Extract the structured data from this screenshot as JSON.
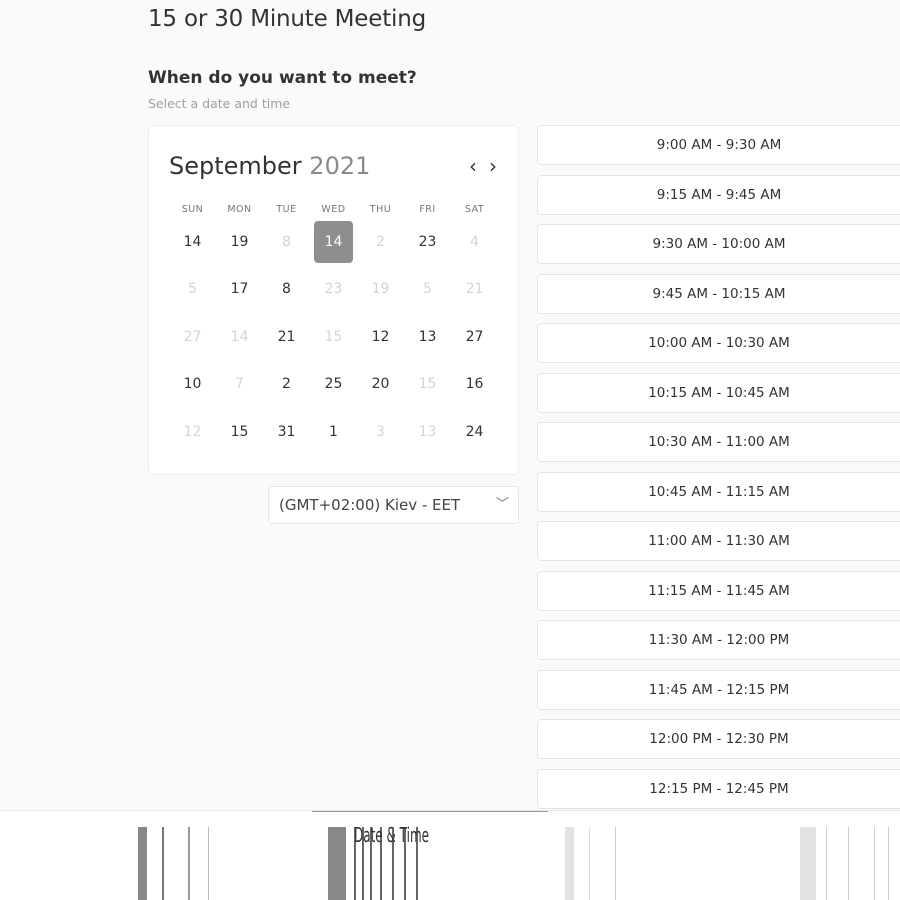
{
  "header": {
    "title": "15 or 30 Minute Meeting",
    "question": "When do you want to meet?",
    "hint": "Select a date and time"
  },
  "calendar": {
    "month": "September",
    "year": "2021",
    "prev_icon": "chevron-left-icon",
    "next_icon": "chevron-right-icon",
    "weekdays": [
      "SUN",
      "MON",
      "TUE",
      "WED",
      "THU",
      "FRI",
      "SAT"
    ],
    "rows": [
      [
        {
          "d": "14",
          "dim": false
        },
        {
          "d": "19",
          "dim": false
        },
        {
          "d": "8",
          "dim": true
        },
        {
          "d": "14",
          "dim": false,
          "selected": true
        },
        {
          "d": "2",
          "dim": true
        },
        {
          "d": "23",
          "dim": false
        },
        {
          "d": "4",
          "dim": true
        }
      ],
      [
        {
          "d": "5",
          "dim": true
        },
        {
          "d": "17",
          "dim": false
        },
        {
          "d": "8",
          "dim": false
        },
        {
          "d": "23",
          "dim": true
        },
        {
          "d": "19",
          "dim": true
        },
        {
          "d": "5",
          "dim": true
        },
        {
          "d": "21",
          "dim": true
        }
      ],
      [
        {
          "d": "27",
          "dim": true
        },
        {
          "d": "14",
          "dim": true
        },
        {
          "d": "21",
          "dim": false
        },
        {
          "d": "15",
          "dim": true
        },
        {
          "d": "12",
          "dim": false
        },
        {
          "d": "13",
          "dim": false
        },
        {
          "d": "27",
          "dim": false
        }
      ],
      [
        {
          "d": "10",
          "dim": false
        },
        {
          "d": "7",
          "dim": true
        },
        {
          "d": "2",
          "dim": false
        },
        {
          "d": "25",
          "dim": false
        },
        {
          "d": "20",
          "dim": false
        },
        {
          "d": "15",
          "dim": true
        },
        {
          "d": "16",
          "dim": false
        }
      ],
      [
        {
          "d": "12",
          "dim": true
        },
        {
          "d": "15",
          "dim": false
        },
        {
          "d": "31",
          "dim": false
        },
        {
          "d": "1",
          "dim": false
        },
        {
          "d": "3",
          "dim": true
        },
        {
          "d": "13",
          "dim": true
        },
        {
          "d": "24",
          "dim": false
        }
      ]
    ]
  },
  "timezone": {
    "value": "(GMT+02:00) Kiev - EET",
    "icon": "chevron-down-icon"
  },
  "slots": [
    "9:00 AM - 9:30 AM",
    "9:15 AM - 9:45 AM",
    "9:30 AM - 10:00 AM",
    "9:45 AM - 10:15 AM",
    "10:00 AM - 10:30 AM",
    "10:15 AM - 10:45 AM",
    "10:30 AM - 11:00 AM",
    "10:45 AM - 11:15 AM",
    "11:00 AM - 11:30 AM",
    "11:15 AM - 11:45 AM",
    "11:30 AM - 12:00 PM",
    "11:45 AM - 12:15 PM",
    "12:00 PM - 12:30 PM",
    "12:15 PM - 12:45 PM"
  ],
  "bottom_tabs": {
    "active_label": "Date & Time",
    "colors": {
      "indicator": "#999999",
      "selected_day": "#8e8e8e"
    }
  }
}
